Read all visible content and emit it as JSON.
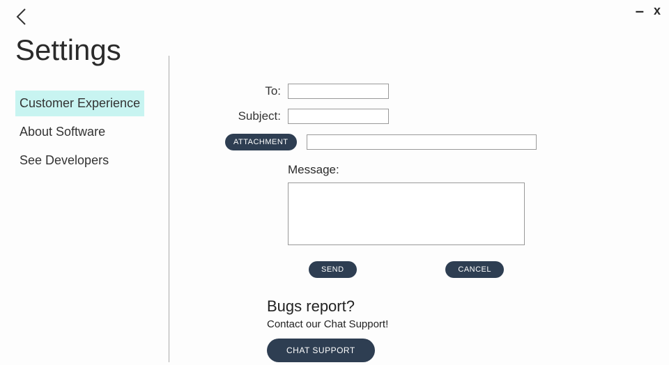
{
  "window": {
    "minimize": "–",
    "close": "x"
  },
  "page_title": "Settings",
  "sidebar": {
    "items": [
      {
        "label": "Customer Experience",
        "active": true
      },
      {
        "label": "About Software",
        "active": false
      },
      {
        "label": "See Developers",
        "active": false
      }
    ]
  },
  "form": {
    "to_label": "To:",
    "to_value": "",
    "subject_label": "Subject:",
    "subject_value": "",
    "attachment_label": "ATTACHMENT",
    "attachment_value": "",
    "message_label": "Message:",
    "message_value": "",
    "send_label": "SEND",
    "cancel_label": "CANCEL"
  },
  "bugs": {
    "title": "Bugs report?",
    "subtitle": "Contact our Chat Support!",
    "button_label": "CHAT SUPPORT"
  }
}
